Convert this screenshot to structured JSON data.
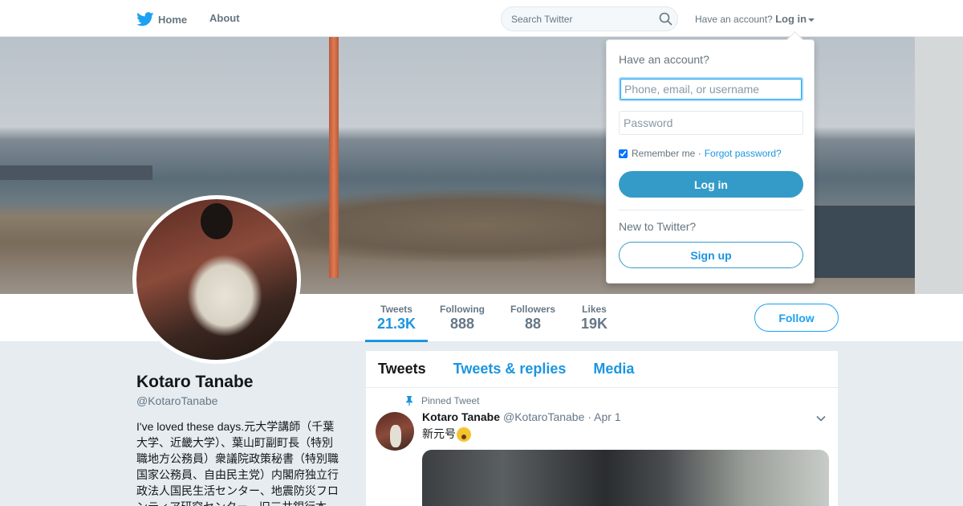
{
  "nav": {
    "home_label": "Home",
    "about_label": "About",
    "search_placeholder": "Search Twitter",
    "account_prompt": "Have an account?",
    "login_label": "Log in"
  },
  "profile": {
    "name": "Kotaro Tanabe",
    "handle": "@KotaroTanabe",
    "bio": "I've loved these days.元大学講師（千葉大学、近畿大学）、葉山町副町長（特別職地方公務員）衆議院政策秘書（特別職国家公務員、自由民主党）内閣府独立行政法人国民生活センター、地震防災フロンティア研究センター、旧三井銀行本",
    "follow_label": "Follow",
    "stats": [
      {
        "label": "Tweets",
        "value": "21.3K"
      },
      {
        "label": "Following",
        "value": "888"
      },
      {
        "label": "Followers",
        "value": "88"
      },
      {
        "label": "Likes",
        "value": "19K"
      }
    ]
  },
  "timeline": {
    "tabs": [
      "Tweets",
      "Tweets & replies",
      "Media"
    ],
    "pinned_label": "Pinned Tweet",
    "tweet": {
      "name": "Kotaro Tanabe",
      "handle": "@KotaroTanabe",
      "date": "· Apr 1",
      "text": "新元号"
    }
  },
  "login_dropdown": {
    "title": "Have an account?",
    "username_placeholder": "Phone, email, or username",
    "password_placeholder": "Password",
    "remember_label": "Remember me ·",
    "forgot_label": "Forgot password?",
    "login_button": "Log in",
    "new_label": "New to Twitter?",
    "signup_button": "Sign up"
  },
  "colors": {
    "brand": "#1da1f2",
    "link": "#1b95e0",
    "muted": "#657786"
  }
}
